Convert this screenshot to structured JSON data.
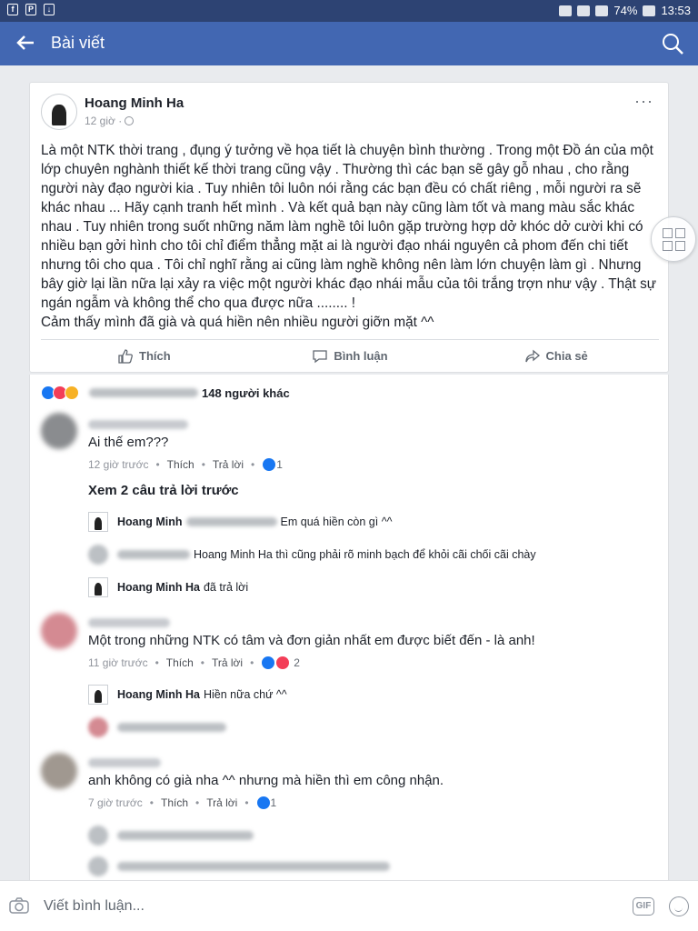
{
  "statusbar": {
    "battery": "74%",
    "time": "13:53"
  },
  "appbar": {
    "title": "Bài viết",
    "back_icon": "back-arrow-icon",
    "search_icon": "search-icon"
  },
  "post": {
    "author": "Hoang Minh Ha",
    "time": "12 giờ ·",
    "text": "Là một NTK thời trang , đụng ý tưởng về họa tiết là chuyện bình thường . Trong một Đồ án của một lớp chuyên nghành thiết kế thời trang cũng vậy . Thường thì các bạn sẽ gây gỗ nhau , cho rằng người này đạo người kia . Tuy nhiên tôi luôn nói rằng các bạn đều có chất riêng , mỗi người ra sẽ khác nhau ... Hãy cạnh tranh hết mình . Và kết quả bạn này cũng làm tốt và mang màu sắc khác nhau . Tuy nhiên trong suốt những năm làm nghề tôi luôn gặp trường hợp dở khóc dở cười khi có nhiều bạn gởi hình cho tôi chỉ điểm thẳng mặt ai là người đạo nhái nguyên cả phom đến chi tiết nhưng tôi cho qua . Tôi chỉ nghĩ rằng ai cũng làm nghề không nên làm lớn chuyện làm gì . Nhưng bây giờ lại lần nữa lại xảy ra việc một người khác đạo nhái mẫu của tôi trắng trợn như vậy . Thật sự ngán ngẫm và không thể cho qua được nữa ........ !\nCảm thấy mình đã già và quá hiền nên nhiều người giỡn mặt ^^",
    "actions": {
      "like": "Thích",
      "comment": "Bình luận",
      "share": "Chia sẻ"
    }
  },
  "reactions": {
    "summary": "148 người khác"
  },
  "comments": [
    {
      "text": "Ai thế em???",
      "time": "12 giờ trước",
      "like": "Thích",
      "reply": "Trả lời",
      "count": "1"
    },
    {
      "text": "Một trong những NTK có tâm và đơn giản nhất em được biết đến - là anh!",
      "time": "11 giờ trước",
      "like": "Thích",
      "reply": "Trả lời",
      "count": "2"
    },
    {
      "text": "anh không có già nha ^^ nhưng mà hiền thì em công nhận.",
      "time": "7 giờ trước",
      "like": "Thích",
      "reply": "Trả lời",
      "count": "1"
    }
  ],
  "see_more_replies": "Xem 2 câu trả lời trước",
  "replies": [
    {
      "name": "Hoang Minh",
      "text": "Em quá hiền còn gì ^^"
    },
    {
      "name": "",
      "text": "Hoang Minh Ha thì cũng phải rõ minh bạch để khỏi cãi chối cãi chày"
    },
    {
      "name": "Hoang Minh Ha",
      "text": "đã trả lời"
    },
    {
      "name": "Hoang Minh Ha",
      "text": "Hiền nữa chứ ^^"
    }
  ],
  "composer": {
    "placeholder": "Viết bình luận...",
    "gif": "GIF"
  }
}
